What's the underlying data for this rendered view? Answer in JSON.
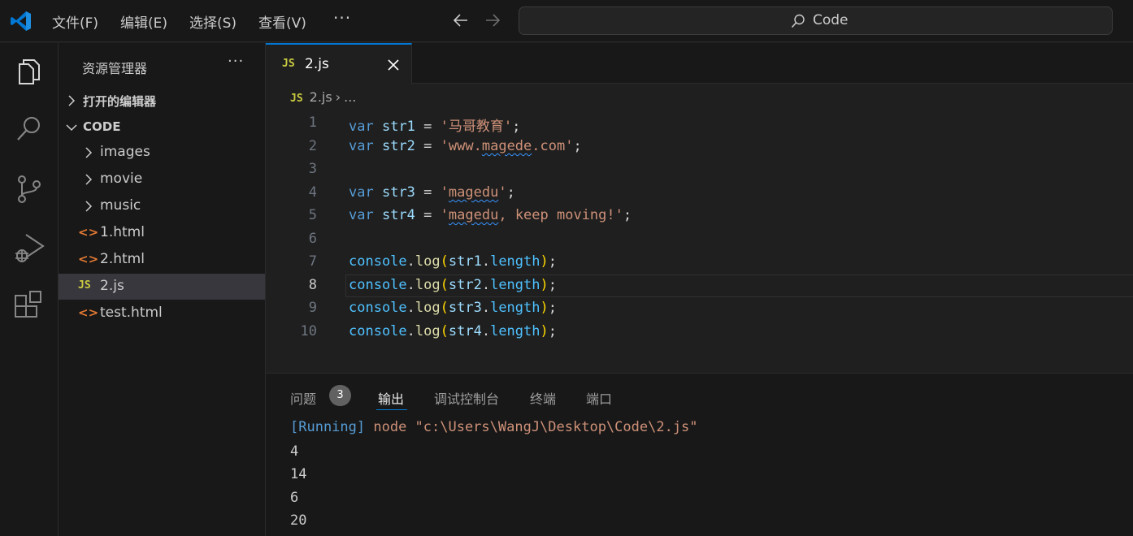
{
  "titlebar": {
    "menus": [
      "文件(F)",
      "编辑(E)",
      "选择(S)",
      "查看(V)",
      "···"
    ],
    "search_text": "Code"
  },
  "activitybar": {
    "items": [
      "explorer",
      "search",
      "source-control",
      "run-debug",
      "extensions"
    ],
    "active": "explorer"
  },
  "sidebar": {
    "title": "资源管理器",
    "more": "···",
    "open_editors_label": "打开的编辑器",
    "folder_label": "CODE",
    "items": [
      {
        "name": "images",
        "type": "folder"
      },
      {
        "name": "movie",
        "type": "folder"
      },
      {
        "name": "music",
        "type": "folder"
      },
      {
        "name": "1.html",
        "type": "html"
      },
      {
        "name": "2.html",
        "type": "html"
      },
      {
        "name": "2.js",
        "type": "js",
        "selected": true
      },
      {
        "name": "test.html",
        "type": "html"
      }
    ],
    "js_icon_text": "JS",
    "html_icon_text": "<>"
  },
  "editor": {
    "tab_name": "2.js",
    "tab_icon_text": "JS",
    "breadcrumb_file": "2.js",
    "breadcrumb_more": "...",
    "line_numbers": [
      "1",
      "2",
      "3",
      "4",
      "5",
      "6",
      "7",
      "8",
      "9",
      "10"
    ],
    "active_line": "8"
  },
  "panel": {
    "tabs": [
      "问题",
      "输出",
      "调试控制台",
      "终端",
      "端口"
    ],
    "problems_count": "3",
    "active_tab": "输出",
    "output_run_tag": "[Running]",
    "output_run_cmd": " node \"c:\\Users\\WangJ\\Desktop\\Code\\2.js\"",
    "output_lines": [
      "4",
      "14",
      "6",
      "20"
    ]
  },
  "colors": {
    "accent": "#0078d4",
    "keyword": "#569cd6",
    "string": "#ce9178",
    "function": "#dcdcaa",
    "variable": "#9cdcfe",
    "html_icon": "#e37933",
    "js_icon": "#cbcb41"
  }
}
